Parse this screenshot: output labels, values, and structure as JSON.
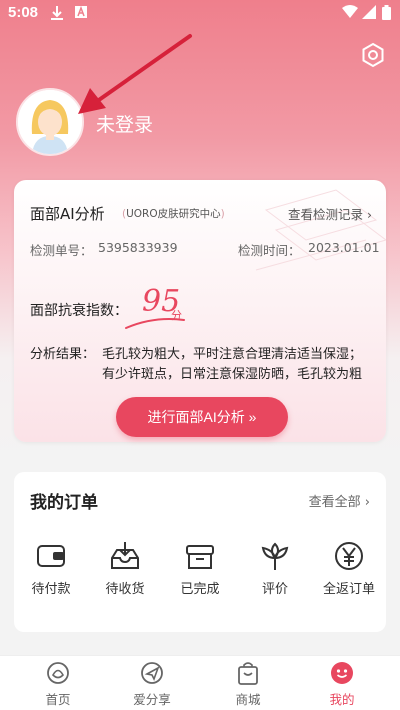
{
  "status_bar": {
    "time": "5:08"
  },
  "profile": {
    "login_label": "未登录"
  },
  "ai_card": {
    "title": "面部AI分析",
    "brand": "UORO皮肤研究中心",
    "records_link": "查看检测记录",
    "test_no_label": "检测单号：",
    "test_no_value": "5395833939",
    "test_time_label": "检测时间：",
    "test_time_value": "2023.01.01",
    "index_label": "面部抗衰指数：",
    "score": "95",
    "score_unit": "分",
    "result_label": "分析结果：",
    "result_line1": "毛孔较为粗大，平时注意合理清洁适当保湿；",
    "result_line2": "有少许斑点，日常注意保湿防晒，毛孔较为粗",
    "button_label": "进行面部AI分析 »"
  },
  "orders": {
    "title": "我的订单",
    "view_all": "查看全部",
    "items": [
      {
        "label": "待付款",
        "icon": "wallet-icon"
      },
      {
        "label": "待收货",
        "icon": "inbox-download-icon"
      },
      {
        "label": "已完成",
        "icon": "box-icon"
      },
      {
        "label": "评价",
        "icon": "flower-icon"
      },
      {
        "label": "全返订单",
        "icon": "yen-coin-icon"
      }
    ]
  },
  "tabbar": {
    "tabs": [
      {
        "label": "首页",
        "icon": "home-icon"
      },
      {
        "label": "爱分享",
        "icon": "share-icon"
      },
      {
        "label": "商城",
        "icon": "shopping-bag-icon"
      },
      {
        "label": "我的",
        "icon": "profile-smile-icon",
        "active": true
      }
    ]
  },
  "colors": {
    "accent": "#e8475f",
    "header_pink": "#ef7f8c"
  }
}
